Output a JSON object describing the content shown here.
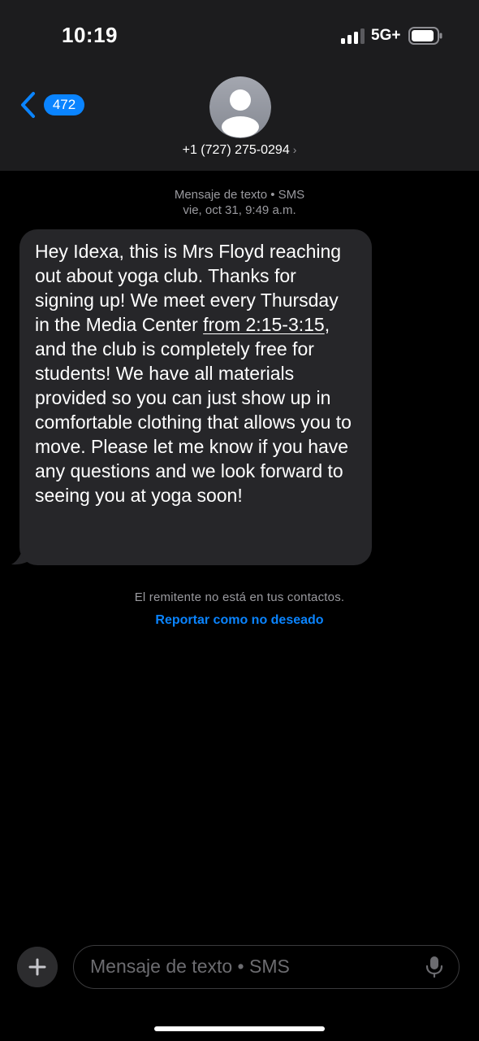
{
  "status_bar": {
    "time": "10:19",
    "network": "5G+",
    "signal_bars_active": 3,
    "signal_bars_total": 4
  },
  "nav": {
    "back_count": "472",
    "contact_number": "+1 (727) 275-0294",
    "contact_chevron": "›"
  },
  "conversation": {
    "service_label": "Mensaje de texto • SMS",
    "timestamp": "vie, oct 31, 9:49 a.m.",
    "message": {
      "text_before_link": "Hey Idexa, this is Mrs Floyd reaching out about yoga club. Thanks for signing up! We meet every Thursday in the Media Center ",
      "link_text": "from 2:15-3:15",
      "text_after_link": ", and the club is completely free for students! We have all materials provided so you can just show up in comfortable clothing that allows you to move. Please let me know if you have any questions and we look forward to seeing you at yoga soon!"
    },
    "notice": "El remitente no está en tus contactos.",
    "report_link": "Reportar como no deseado"
  },
  "compose": {
    "placeholder": "Mensaje de texto • SMS"
  },
  "colors": {
    "accent": "#0a84ff",
    "header_bg": "#1c1c1e",
    "bubble_bg": "#262629",
    "secondary_text": "#9a9a9f"
  },
  "icons": {
    "back": "chevron-left-icon",
    "avatar": "person-icon",
    "plus": "plus-icon",
    "mic": "microphone-icon",
    "battery": "battery-icon",
    "signal": "signal-bars-icon"
  }
}
